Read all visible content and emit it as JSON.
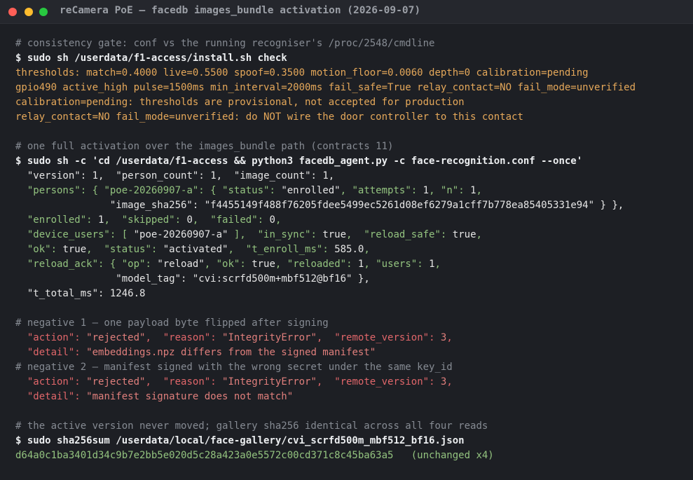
{
  "window": {
    "title": "reCamera PoE — facedb images_bundle activation (2026-09-07)"
  },
  "terminal": {
    "lines": [
      {
        "text": "# consistency gate: conf vs the running recogniser's /proc/2548/cmdline",
        "style": "comment"
      },
      {
        "text": "$ sudo sh /userdata/f1-access/install.sh check",
        "style": "cmd"
      },
      {
        "text": "thresholds: match=0.4000 live=0.5500 spoof=0.3500 motion_floor=0.0060 depth=0 calibration=pending",
        "style": "warn"
      },
      {
        "text": "gpio490 active_high pulse=1500ms min_interval=2000ms fail_safe=True relay_contact=NO fail_mode=unverified",
        "style": "warn"
      },
      {
        "text": "calibration=pending: thresholds are provisional, not accepted for production",
        "style": "warn"
      },
      {
        "text": "relay_contact=NO fail_mode=unverified: do NOT wire the door controller to this contact",
        "style": "warn"
      },
      {
        "text": "",
        "style": "blank"
      },
      {
        "text": "# one full activation over the images_bundle path (contracts 11)",
        "style": "comment"
      },
      {
        "text": "$ sudo sh -c 'cd /userdata/f1-access && python3 facedb_agent.py -c face-recognition.conf --once'",
        "style": "cmd"
      },
      {
        "text": "  \"version\": 1,  \"person_count\": 1,  \"image_count\": 1,",
        "style": "val"
      },
      {
        "text": "  \"persons\": { \"poe-20260907-a\": { \"status\": \"enrolled\", \"attempts\": 1, \"n\": 1,",
        "style": "key"
      },
      {
        "text": "                \"image_sha256\": \"f4455149f488f76205fdee5499ec5261d08ef6279a1cff7b778ea85405331e94\" } },",
        "style": "val"
      },
      {
        "text": "  \"enrolled\": 1,  \"skipped\": 0,  \"failed\": 0,",
        "style": "key"
      },
      {
        "text": "  \"device_users\": [ \"poe-20260907-a\" ],  \"in_sync\": true,  \"reload_safe\": true,",
        "style": "key"
      },
      {
        "text": "  \"ok\": true,  \"status\": \"activated\",  \"t_enroll_ms\": 585.0,",
        "style": "key"
      },
      {
        "text": "  \"reload_ack\": { \"op\": \"reload\", \"ok\": true, \"reloaded\": 1, \"users\": 1,",
        "style": "key"
      },
      {
        "text": "                 \"model_tag\": \"cvi:scrfd500m+mbf512@bf16\" },",
        "style": "val"
      },
      {
        "text": "  \"t_total_ms\": 1246.8",
        "style": "val"
      },
      {
        "text": "",
        "style": "blank"
      },
      {
        "text": "# negative 1 — one payload byte flipped after signing",
        "style": "comment"
      },
      {
        "text": "  \"action\": \"rejected\",  \"reason\": \"IntegrityError\",  \"remote_version\": 3,",
        "style": "err"
      },
      {
        "text": "  \"detail\": \"embeddings.npz differs from the signed manifest\"",
        "style": "err"
      },
      {
        "text": "# negative 2 — manifest signed with the wrong secret under the same key_id",
        "style": "comment"
      },
      {
        "text": "  \"action\": \"rejected\",  \"reason\": \"IntegrityError\",  \"remote_version\": 3,",
        "style": "err"
      },
      {
        "text": "  \"detail\": \"manifest signature does not match\"",
        "style": "err"
      },
      {
        "text": "",
        "style": "blank"
      },
      {
        "text": "# the active version never moved; gallery sha256 identical across all four reads",
        "style": "comment"
      },
      {
        "text": "$ sudo sha256sum /userdata/local/face-gallery/cvi_scrfd500m_mbf512_bf16.json",
        "style": "cmd"
      },
      {
        "text": "d64a0c1ba3401d34c9b7e2bb5e020d5c28a423a0e5572c00cd371c8c45ba63a5   (unchanged x4)",
        "style": "hash"
      }
    ]
  },
  "colors": {
    "background": "#1d1f24",
    "comment": "#868b93",
    "command": "#eceef0",
    "warning": "#e5a85a",
    "json_key": "#93c37f",
    "error": "#e0666a"
  }
}
